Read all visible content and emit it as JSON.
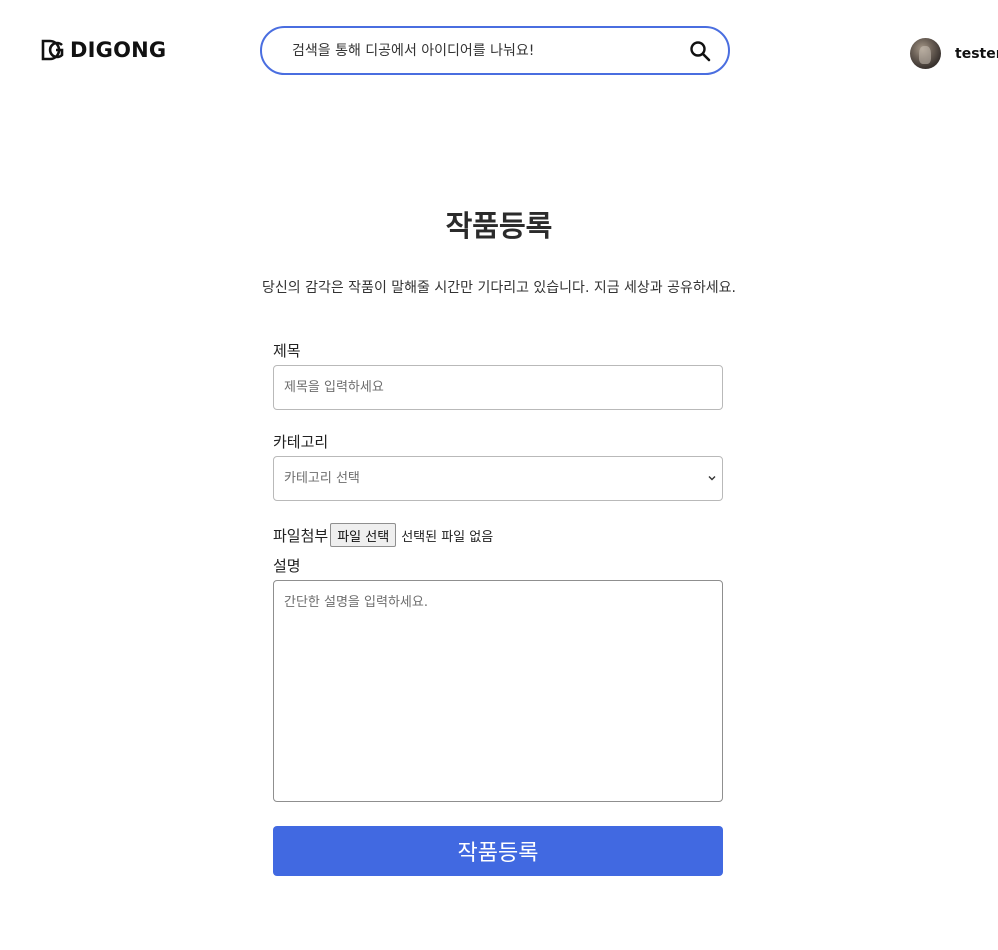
{
  "header": {
    "logo_text": "DIGONG",
    "search_placeholder": "검색을 통해 디공에서 아이디어를 나눠요!",
    "username": "tester"
  },
  "main": {
    "title": "작품등록",
    "subtitle": "당신의 감각은 작품이 말해줄 시간만 기다리고 있습니다. 지금 세상과 공유하세요.",
    "form": {
      "title_label": "제목",
      "title_placeholder": "제목을 입력하세요",
      "category_label": "카테고리",
      "category_selected": "카테고리 선택",
      "file_label": "파일첨부",
      "file_button": "파일 선택",
      "file_status": "선택된 파일 없음",
      "description_label": "설명",
      "description_placeholder": "간단한 설명을 입력하세요.",
      "submit_label": "작품등록"
    }
  },
  "colors": {
    "accent": "#4169e1",
    "search_border": "#4a6ee0"
  }
}
